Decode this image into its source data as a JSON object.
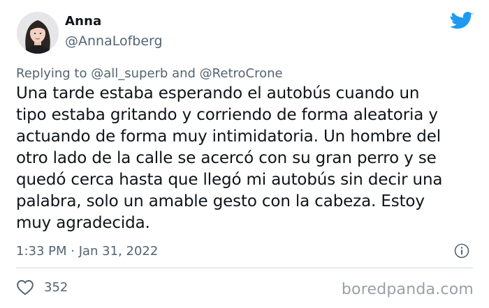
{
  "author": {
    "display_name": "Anna",
    "handle": "@AnnaLofberg"
  },
  "reply_context": {
    "prefix": "Replying to ",
    "mention_1": "@all_superb",
    "joiner": " and ",
    "mention_2": "@RetroCrone"
  },
  "tweet": {
    "lines": [
      "Una tarde estaba esperando el autobús cuando un",
      "tipo estaba gritando y corriendo de forma aleatoria y",
      "actuando de forma muy intimidatoria. Un hombre del",
      "otro lado de la calle se acercó con su gran perro y se",
      "quedó cerca hasta que llegó mi autobús sin decir una",
      "palabra, solo un amable gesto con la cabeza. Estoy",
      "muy agradecida."
    ],
    "timestamp": "1:33 PM · Jan 31, 2022"
  },
  "engagement": {
    "likes": "352"
  },
  "watermark": "boredpanda.com",
  "colors": {
    "twitter_blue": "#1d9bf0",
    "secondary_text": "#536471",
    "primary_text": "#0f1419",
    "divider": "#cfd9de"
  },
  "icons": {
    "logo": "twitter-bird-icon",
    "info": "info-icon",
    "like": "heart-icon"
  }
}
